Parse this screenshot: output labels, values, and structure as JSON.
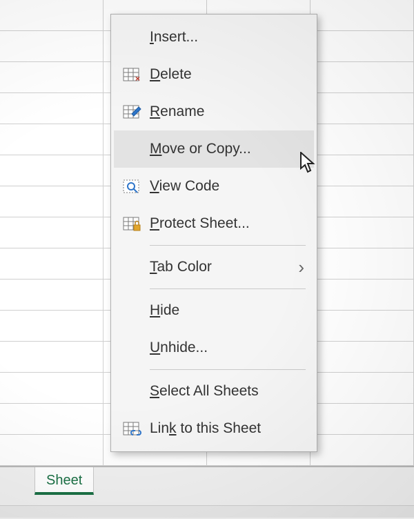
{
  "tab": {
    "active_label": "Sheet"
  },
  "context_menu": {
    "items": [
      {
        "pre": "",
        "mn": "I",
        "post": "nsert...",
        "icon": null,
        "submenu": false,
        "hovered": false
      },
      {
        "pre": "",
        "mn": "D",
        "post": "elete",
        "icon": "delete",
        "submenu": false,
        "hovered": false
      },
      {
        "pre": "",
        "mn": "R",
        "post": "ename",
        "icon": "rename",
        "submenu": false,
        "hovered": false
      },
      {
        "pre": "",
        "mn": "M",
        "post": "ove or Copy...",
        "icon": null,
        "submenu": false,
        "hovered": true
      },
      {
        "pre": "",
        "mn": "V",
        "post": "iew Code",
        "icon": "view-code",
        "submenu": false,
        "hovered": false
      },
      {
        "pre": "",
        "mn": "P",
        "post": "rotect Sheet...",
        "icon": "protect",
        "submenu": false,
        "hovered": false
      },
      {
        "sep": true
      },
      {
        "pre": "",
        "mn": "T",
        "post": "ab Color",
        "icon": null,
        "submenu": true,
        "hovered": false
      },
      {
        "sep": true
      },
      {
        "pre": "",
        "mn": "H",
        "post": "ide",
        "icon": null,
        "submenu": false,
        "hovered": false
      },
      {
        "pre": "",
        "mn": "U",
        "post": "nhide...",
        "icon": null,
        "submenu": false,
        "hovered": false
      },
      {
        "sep": true
      },
      {
        "pre": "",
        "mn": "S",
        "post": "elect All Sheets",
        "icon": null,
        "submenu": false,
        "hovered": false
      },
      {
        "pre": "Lin",
        "mn": "k",
        "post": " to this Sheet",
        "icon": "link",
        "submenu": false,
        "hovered": false
      }
    ]
  },
  "icons": {
    "delete": "delete-sheet-icon",
    "rename": "rename-sheet-icon",
    "view-code": "view-code-icon",
    "protect": "protect-sheet-icon",
    "link": "link-sheet-icon"
  }
}
